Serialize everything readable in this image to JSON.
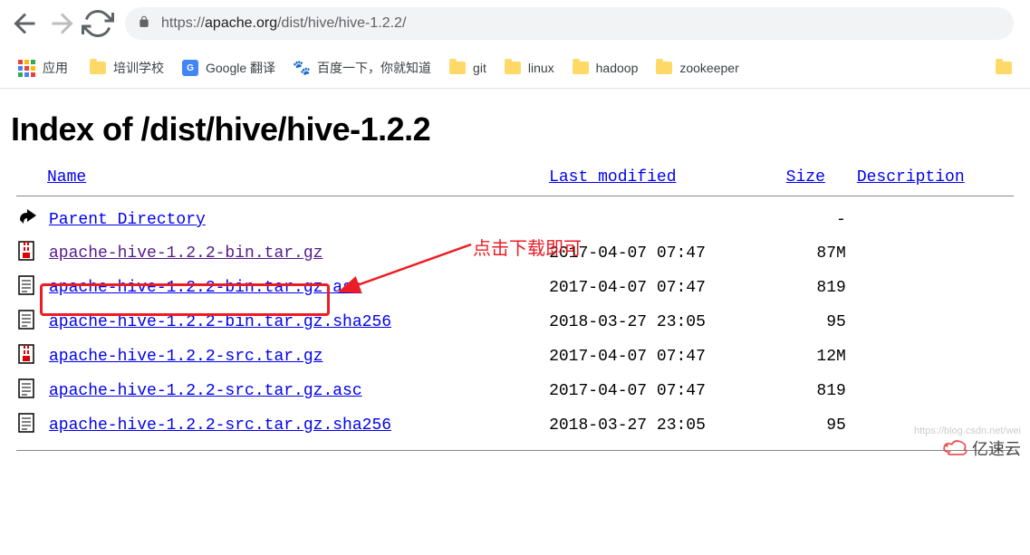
{
  "browser": {
    "url_protocol": "https://",
    "url_domain": "apache.org",
    "url_path": "/dist/hive/hive-1.2.2/"
  },
  "bookmarks": {
    "apps": "应用",
    "items": [
      {
        "label": "培训学校",
        "icon": "folder"
      },
      {
        "label": "Google 翻译",
        "icon": "gtranslate"
      },
      {
        "label": "百度一下，你就知道",
        "icon": "baidu"
      },
      {
        "label": "git",
        "icon": "folder"
      },
      {
        "label": "linux",
        "icon": "folder"
      },
      {
        "label": "hadoop",
        "icon": "folder"
      },
      {
        "label": "zookeeper",
        "icon": "folder"
      }
    ]
  },
  "page": {
    "title": "Index of /dist/hive/hive-1.2.2",
    "headers": {
      "name": "Name",
      "modified": "Last modified",
      "size": "Size",
      "description": "Description"
    },
    "parent": {
      "label": "Parent Directory",
      "size": "-"
    },
    "files": [
      {
        "name": "apache-hive-1.2.2-bin.tar.gz",
        "modified": "2017-04-07 07:47",
        "size": "87M",
        "icon": "archive",
        "visited": true,
        "highlighted": true
      },
      {
        "name": "apache-hive-1.2.2-bin.tar.gz.asc",
        "modified": "2017-04-07 07:47",
        "size": "819",
        "icon": "text"
      },
      {
        "name": "apache-hive-1.2.2-bin.tar.gz.sha256",
        "modified": "2018-03-27 23:05",
        "size": "95",
        "icon": "text"
      },
      {
        "name": "apache-hive-1.2.2-src.tar.gz",
        "modified": "2017-04-07 07:47",
        "size": "12M",
        "icon": "archive"
      },
      {
        "name": "apache-hive-1.2.2-src.tar.gz.asc",
        "modified": "2017-04-07 07:47",
        "size": "819",
        "icon": "text"
      },
      {
        "name": "apache-hive-1.2.2-src.tar.gz.sha256",
        "modified": "2018-03-27 23:05",
        "size": "95",
        "icon": "text"
      }
    ]
  },
  "annotation": {
    "label": "点击下载即可"
  },
  "watermark": {
    "brand": "亿速云",
    "url": "https://blog.csdn.net/wei"
  }
}
